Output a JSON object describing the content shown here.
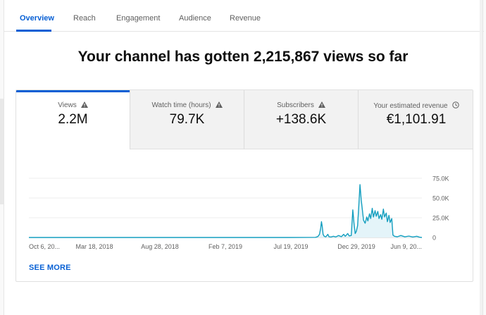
{
  "tabs": [
    {
      "label": "Overview",
      "active": true
    },
    {
      "label": "Reach",
      "active": false
    },
    {
      "label": "Engagement",
      "active": false
    },
    {
      "label": "Audience",
      "active": false
    },
    {
      "label": "Revenue",
      "active": false
    }
  ],
  "headline": "Your channel has gotten 2,215,867 views so far",
  "metrics": [
    {
      "label": "Views",
      "value": "2.2M",
      "icon": "warning-icon"
    },
    {
      "label": "Watch time (hours)",
      "value": "79.7K",
      "icon": "warning-icon"
    },
    {
      "label": "Subscribers",
      "value": "+138.6K",
      "icon": "warning-icon"
    },
    {
      "label": "Your estimated revenue",
      "value": "€1,101.91",
      "icon": "clock-icon"
    }
  ],
  "colors": {
    "accent": "#065fd4",
    "line": "#139ebf",
    "area": "#e4f4f9"
  },
  "chart_data": {
    "type": "area",
    "series_metric": "Views",
    "ylim": [
      0,
      75000
    ],
    "y_ticks": [
      {
        "value": 75000,
        "label": "75.0K"
      },
      {
        "value": 50000,
        "label": "50.0K"
      },
      {
        "value": 25000,
        "label": "25.0K"
      },
      {
        "value": 0,
        "label": "0"
      }
    ],
    "x_ticks": [
      "Oct 6, 20...",
      "Mar 18, 2018",
      "Aug 28, 2018",
      "Feb 7, 2019",
      "Jul 19, 2019",
      "Dec 29, 2019",
      "Jun 9, 20..."
    ],
    "series": [
      {
        "points": [
          [
            "2017-10-06",
            0
          ],
          [
            "2018-03-18",
            0
          ],
          [
            "2018-08-28",
            0
          ],
          [
            "2019-02-07",
            0
          ],
          [
            "2019-07-19",
            0
          ],
          [
            "2019-09-28",
            200
          ],
          [
            "2019-10-04",
            1200
          ],
          [
            "2019-10-08",
            4000
          ],
          [
            "2019-10-11",
            12000
          ],
          [
            "2019-10-13",
            20000
          ],
          [
            "2019-10-15",
            14000
          ],
          [
            "2019-10-17",
            4000
          ],
          [
            "2019-10-20",
            1500
          ],
          [
            "2019-10-24",
            800
          ],
          [
            "2019-10-29",
            4000
          ],
          [
            "2019-11-01",
            1000
          ],
          [
            "2019-11-06",
            600
          ],
          [
            "2019-11-12",
            1500
          ],
          [
            "2019-11-18",
            700
          ],
          [
            "2019-11-25",
            2500
          ],
          [
            "2019-12-02",
            1000
          ],
          [
            "2019-12-08",
            4000
          ],
          [
            "2019-12-12",
            1500
          ],
          [
            "2019-12-18",
            5000
          ],
          [
            "2019-12-22",
            2000
          ],
          [
            "2019-12-27",
            2500
          ],
          [
            "2019-12-31",
            35000
          ],
          [
            "2020-01-03",
            18000
          ],
          [
            "2020-01-06",
            5000
          ],
          [
            "2020-01-09",
            8000
          ],
          [
            "2020-01-12",
            15000
          ],
          [
            "2020-01-15",
            40000
          ],
          [
            "2020-01-18",
            67000
          ],
          [
            "2020-01-21",
            48000
          ],
          [
            "2020-01-24",
            35000
          ],
          [
            "2020-01-27",
            22000
          ],
          [
            "2020-01-31",
            18000
          ],
          [
            "2020-02-04",
            26000
          ],
          [
            "2020-02-07",
            21000
          ],
          [
            "2020-02-11",
            30000
          ],
          [
            "2020-02-14",
            24000
          ],
          [
            "2020-02-18",
            37000
          ],
          [
            "2020-02-21",
            26000
          ],
          [
            "2020-02-25",
            34000
          ],
          [
            "2020-02-28",
            27000
          ],
          [
            "2020-03-03",
            33000
          ],
          [
            "2020-03-06",
            24000
          ],
          [
            "2020-03-10",
            29000
          ],
          [
            "2020-03-13",
            23000
          ],
          [
            "2020-03-17",
            36000
          ],
          [
            "2020-03-20",
            26000
          ],
          [
            "2020-03-24",
            31000
          ],
          [
            "2020-03-27",
            20000
          ],
          [
            "2020-03-31",
            28000
          ],
          [
            "2020-04-03",
            19000
          ],
          [
            "2020-04-07",
            24000
          ],
          [
            "2020-04-10",
            3000
          ],
          [
            "2020-04-14",
            1500
          ],
          [
            "2020-04-21",
            900
          ],
          [
            "2020-04-30",
            2500
          ],
          [
            "2020-05-10",
            800
          ],
          [
            "2020-05-20",
            1800
          ],
          [
            "2020-05-30",
            600
          ],
          [
            "2020-06-09",
            1500
          ],
          [
            "2020-06-16",
            400
          ],
          [
            "2020-06-22",
            0
          ]
        ]
      }
    ]
  },
  "see_more_label": "SEE MORE"
}
